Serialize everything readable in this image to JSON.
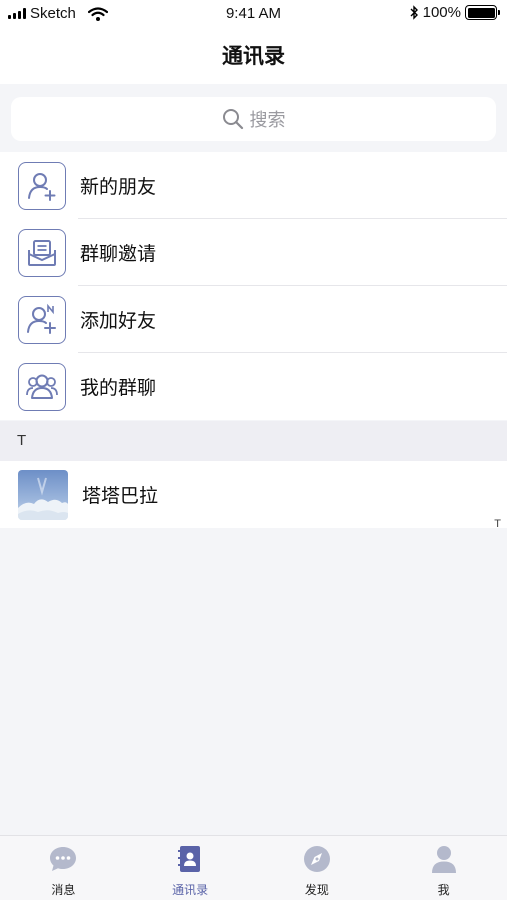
{
  "status_bar": {
    "carrier": "Sketch",
    "time": "9:41 AM",
    "battery": "100%",
    "signal_bars": 4
  },
  "nav": {
    "title": "通讯录"
  },
  "search": {
    "placeholder": "搜索",
    "icon": "search-icon"
  },
  "menu": [
    {
      "label": "新的朋友",
      "icon": "user-plus-icon"
    },
    {
      "label": "群聊邀请",
      "icon": "envelope-icon"
    },
    {
      "label": "添加好友",
      "icon": "user-add-n-icon"
    },
    {
      "label": "我的群聊",
      "icon": "group-icon"
    }
  ],
  "contacts": {
    "section_letter": "T",
    "items": [
      {
        "name": "塔塔巴拉",
        "avatar": "sky-avatar"
      }
    ],
    "index": [
      "T"
    ]
  },
  "tabs": [
    {
      "label": "消息",
      "icon": "chat-bubble-icon",
      "active": false
    },
    {
      "label": "通讯录",
      "icon": "contacts-book-icon",
      "active": true
    },
    {
      "label": "发现",
      "icon": "compass-icon",
      "active": false
    },
    {
      "label": "我",
      "icon": "person-icon",
      "active": false
    }
  ],
  "colors": {
    "accent": "#5a63a8",
    "icon_outline": "#6f7cb4",
    "tab_inactive": "#b4b9cc",
    "background": "#f4f5f8"
  }
}
